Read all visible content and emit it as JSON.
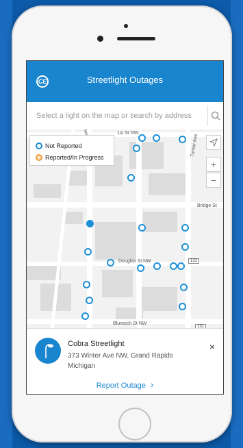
{
  "app": {
    "title": "Streetlight Outages",
    "logo_text": "CE"
  },
  "search": {
    "placeholder": "Select a light on the map or search by address"
  },
  "legend": {
    "not_reported": "Not Reported",
    "reported": "Reported/In Progress"
  },
  "map": {
    "streets": {
      "first_st": "1st St NW",
      "turner_ave": "Turner Ave",
      "avenue_partial": "Ave",
      "bridge_st": "Bridge St",
      "douglas_st": "Douglas St NW",
      "blumrich_st": "Blumrich St NW"
    },
    "highway_shield": "131",
    "highway_shield_bottom": "131",
    "controls": {
      "locate": "locate",
      "zoom_in": "+",
      "zoom_out": "−"
    }
  },
  "selected_light": {
    "name": "Cobra Streetlight",
    "address": "373 Winter Ave NW, Grand Rapids Michigan",
    "report_label": "Report Outage",
    "close": "×",
    "chevron": "›"
  },
  "colors": {
    "accent": "#1a85cf",
    "pin": "#1a8fd6",
    "reported": "#f39a3a"
  }
}
